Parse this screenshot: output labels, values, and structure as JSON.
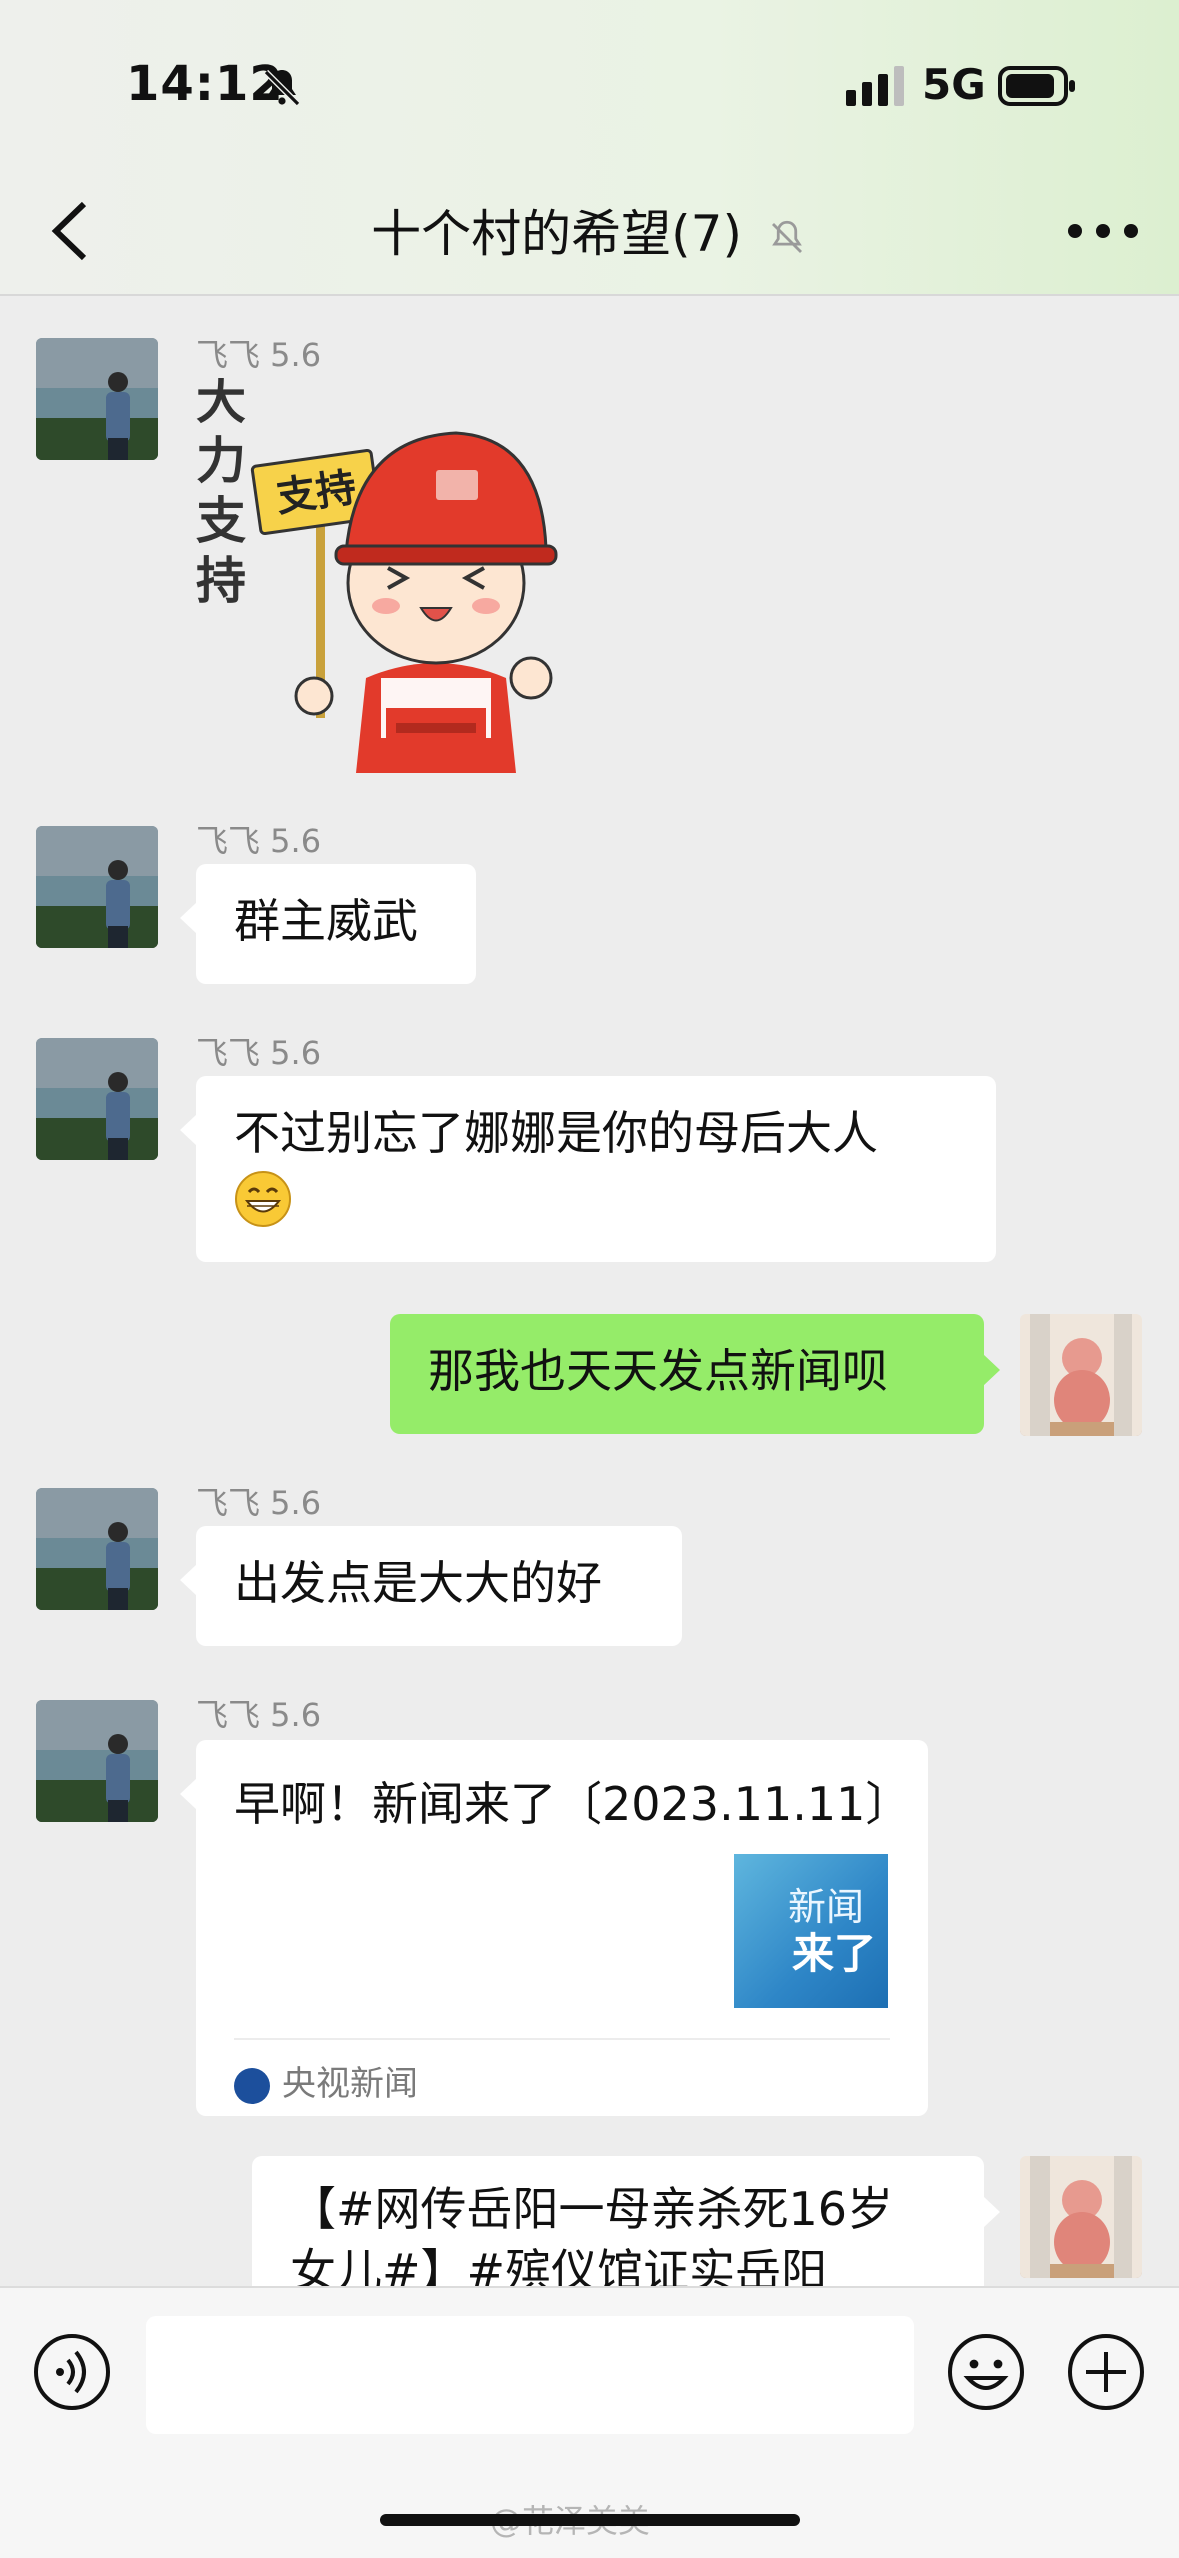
{
  "status_bar": {
    "time": "14:12",
    "network": "5G"
  },
  "header": {
    "title": "十个村的希望(7)"
  },
  "messages": [
    {
      "sender": "飞飞 5.6"
    },
    {
      "sender": "飞飞 5.6",
      "text": "群主威武"
    },
    {
      "sender": "飞飞 5.6",
      "text_line1": "不过别忘了娜娜是你的母后大人"
    },
    {
      "text": "那我也天天发点新闻呗"
    },
    {
      "sender": "飞飞 5.6",
      "text": "出发点是大大的好"
    },
    {
      "sender": "飞飞 5.6",
      "card": {
        "title": "早啊！新闻来了〔2023.11.11〕",
        "thumb_line1": "新闻",
        "thumb_line2": "来了",
        "source": "央视新闻"
      }
    },
    {
      "text_line1": "【#网传岳阳一母亲杀死16岁",
      "text_line2": "女儿#】#殡仪馆证实岳阳"
    }
  ],
  "sticker": {
    "side_text": "大力支持",
    "sign_text": "支持"
  },
  "watermark": "@花泽美美",
  "colors": {
    "my_bubble": "#95ec69",
    "bg": "#ededed"
  }
}
